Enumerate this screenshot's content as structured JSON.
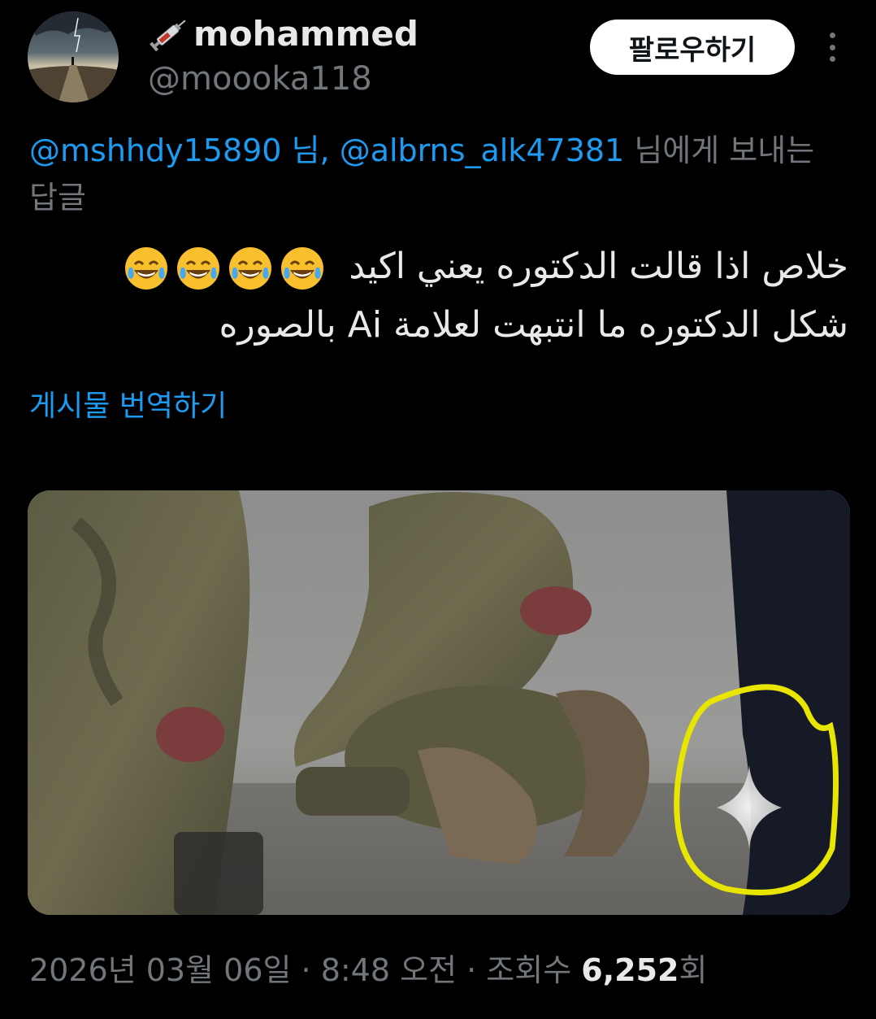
{
  "user": {
    "name": "mohammed",
    "handle": "@moooka118",
    "follow_label": "팔로우하기"
  },
  "reply_context": {
    "mention1": "@mshhdy15890",
    "sep1": " 님, ",
    "mention2": "@albrns_alk47381",
    "suffix": " 님에게 보내는",
    "line2": "답글"
  },
  "tweet": {
    "line1": "خلاص اذا قالت الدكتوره يعني اكيد",
    "line2": "شكل الدكتوره ما انتبهت لعلامة Ai بالصوره",
    "emoji": [
      "face-with-tears-of-joy",
      "face-with-tears-of-joy",
      "face-with-tears-of-joy",
      "face-with-tears-of-joy"
    ],
    "translate_label": "게시물 번역하기"
  },
  "media": {
    "description_icon": "ai-sparkle-watermark",
    "highlight_color": "#e8e600"
  },
  "meta": {
    "date": "2026년 03월 06일",
    "dot1": " · ",
    "time": "8:48 오전",
    "dot2": " · ",
    "views_label": "조회수 ",
    "views_count": "6,252",
    "views_suffix": "회"
  },
  "colors": {
    "background": "#000000",
    "text": "#e7e9ea",
    "secondary": "#71767b",
    "link": "#1d9bf0"
  }
}
